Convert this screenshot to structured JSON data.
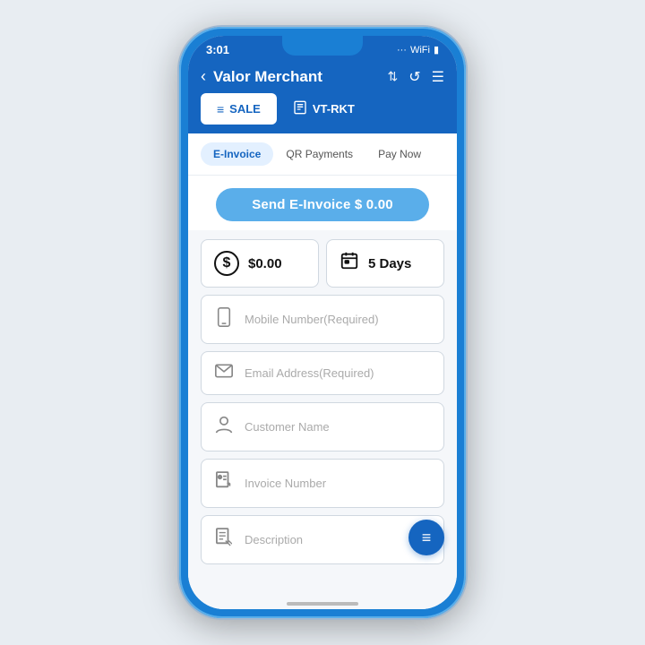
{
  "phone": {
    "status_bar": {
      "time": "3:01",
      "signal": "●●●",
      "wifi": "WiFi",
      "battery": "🔋"
    },
    "header": {
      "back_label": "‹",
      "title": "Valor Merchant",
      "sort_icon": "⇅",
      "refresh_icon": "↺",
      "menu_icon": "☰"
    },
    "tabs": [
      {
        "id": "sale",
        "label": "SALE",
        "icon": "≡",
        "active": true
      },
      {
        "id": "vt-rkt",
        "label": "VT-RKT",
        "icon": "🖩",
        "active": false
      }
    ],
    "sub_tabs": [
      {
        "id": "einvoice",
        "label": "E-Invoice",
        "active": true
      },
      {
        "id": "qr",
        "label": "QR Payments",
        "active": false
      },
      {
        "id": "paynow",
        "label": "Pay Now",
        "active": false
      }
    ],
    "send_button_label": "Send E-Invoice $ 0.00",
    "amount": {
      "value": "$0.00",
      "icon": "$"
    },
    "days": {
      "value": "5 Days",
      "icon": "📅"
    },
    "fields": [
      {
        "id": "mobile",
        "placeholder": "Mobile Number(Required)",
        "icon": "📱"
      },
      {
        "id": "email",
        "placeholder": "Email Address(Required)",
        "icon": "✉"
      },
      {
        "id": "customer_name",
        "placeholder": "Customer Name",
        "icon": "👤"
      },
      {
        "id": "invoice_number",
        "placeholder": "Invoice Number",
        "icon": "📄"
      },
      {
        "id": "description",
        "placeholder": "Description",
        "icon": "📋"
      }
    ],
    "fab_icon": "≡",
    "colors": {
      "primary": "#1565c0",
      "secondary": "#5aaeea",
      "background": "#f5f7fa",
      "border": "#d0d8e0"
    }
  }
}
